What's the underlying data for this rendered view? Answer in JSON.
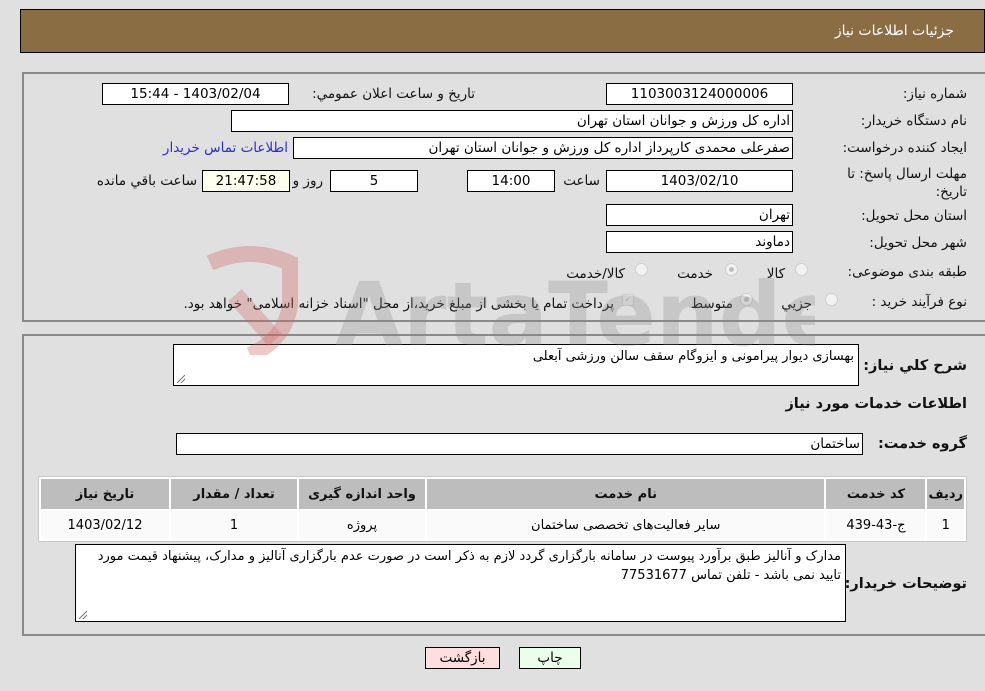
{
  "header": {
    "title": "جزئیات اطلاعات نیاز"
  },
  "details": {
    "need_number_label": "شماره نیاز:",
    "need_number": "1103003124000006",
    "announce_label": "تاریخ و ساعت اعلان عمومي:",
    "announce_value": "1403/02/04 - 15:44",
    "buyer_org_label": "نام دستگاه خريدار:",
    "buyer_org": "اداره کل ورزش و جوانان استان تهران",
    "requester_label": "ایجاد کننده درخواست:",
    "requester": "صفرعلی محمدی کارپرداز اداره کل ورزش و جوانان استان تهران",
    "buyer_contact_link": "اطلاعات تماس خریدار",
    "deadline_label": "مهلت ارسال پاسخ: تا تاریخ:",
    "deadline_date": "1403/02/10",
    "time_label": "ساعت",
    "deadline_time": "14:00",
    "days_value": "5",
    "days_label": "روز و",
    "remaining_time": "21:47:58",
    "remaining_label": "ساعت باقي مانده",
    "province_label": "استان محل تحویل:",
    "province": "تهران",
    "city_label": "شهر محل تحویل:",
    "city": "دماوند",
    "category_label": "طبقه بندی موضوعی:",
    "category_options": [
      {
        "label": "کالا",
        "checked": false
      },
      {
        "label": "خدمت",
        "checked": true
      },
      {
        "label": "کالا/خدمت",
        "checked": false
      }
    ],
    "purchase_type_label": "نوع فرآیند خرید :",
    "purchase_type_options": [
      {
        "label": "جزيي",
        "checked": false
      },
      {
        "label": "متوسط",
        "checked": true
      }
    ],
    "treasury_note": "پرداخت تمام یا بخشی از مبلغ خرید،از محل \"اسناد خزانه اسلامی\" خواهد بود."
  },
  "summary": {
    "description_label": "شرح کلي نياز:",
    "description": "بهسازی دیوار پیرامونی و ایزوگام سقف سالن ورزشی آبعلی",
    "services_heading": "اطلاعات خدمات مورد نیاز",
    "service_group_label": "گروه خدمت:",
    "service_group": "ساختمان"
  },
  "table": {
    "headers": [
      "رديف",
      "کد خدمت",
      "نام خدمت",
      "واحد اندازه گیری",
      "تعداد / مقدار",
      "تاریخ نیاز"
    ],
    "rows": [
      [
        "1",
        "ج-43-439",
        "سایر فعالیت‌های تخصصی ساختمان",
        "پروژه",
        "1",
        "1403/02/12"
      ]
    ]
  },
  "buyer_notes": {
    "label": "توضیحات خریدار:",
    "text": "مدارک و آنالیز طبق برآورد پیوست در سامانه بارگزاری گردد لازم به ذکر است در صورت عدم بارگزاری آنالیز و مدارک، پیشنهاد قیمت مورد تایید نمی باشد  - تلفن تماس 77531677"
  },
  "buttons": {
    "print": "چاپ",
    "back": "بازگشت"
  },
  "colors": {
    "header_bg": "#8b6d43",
    "link": "#2b2bd6",
    "back_btn": "#ffdede",
    "print_btn": "#eaffea"
  }
}
